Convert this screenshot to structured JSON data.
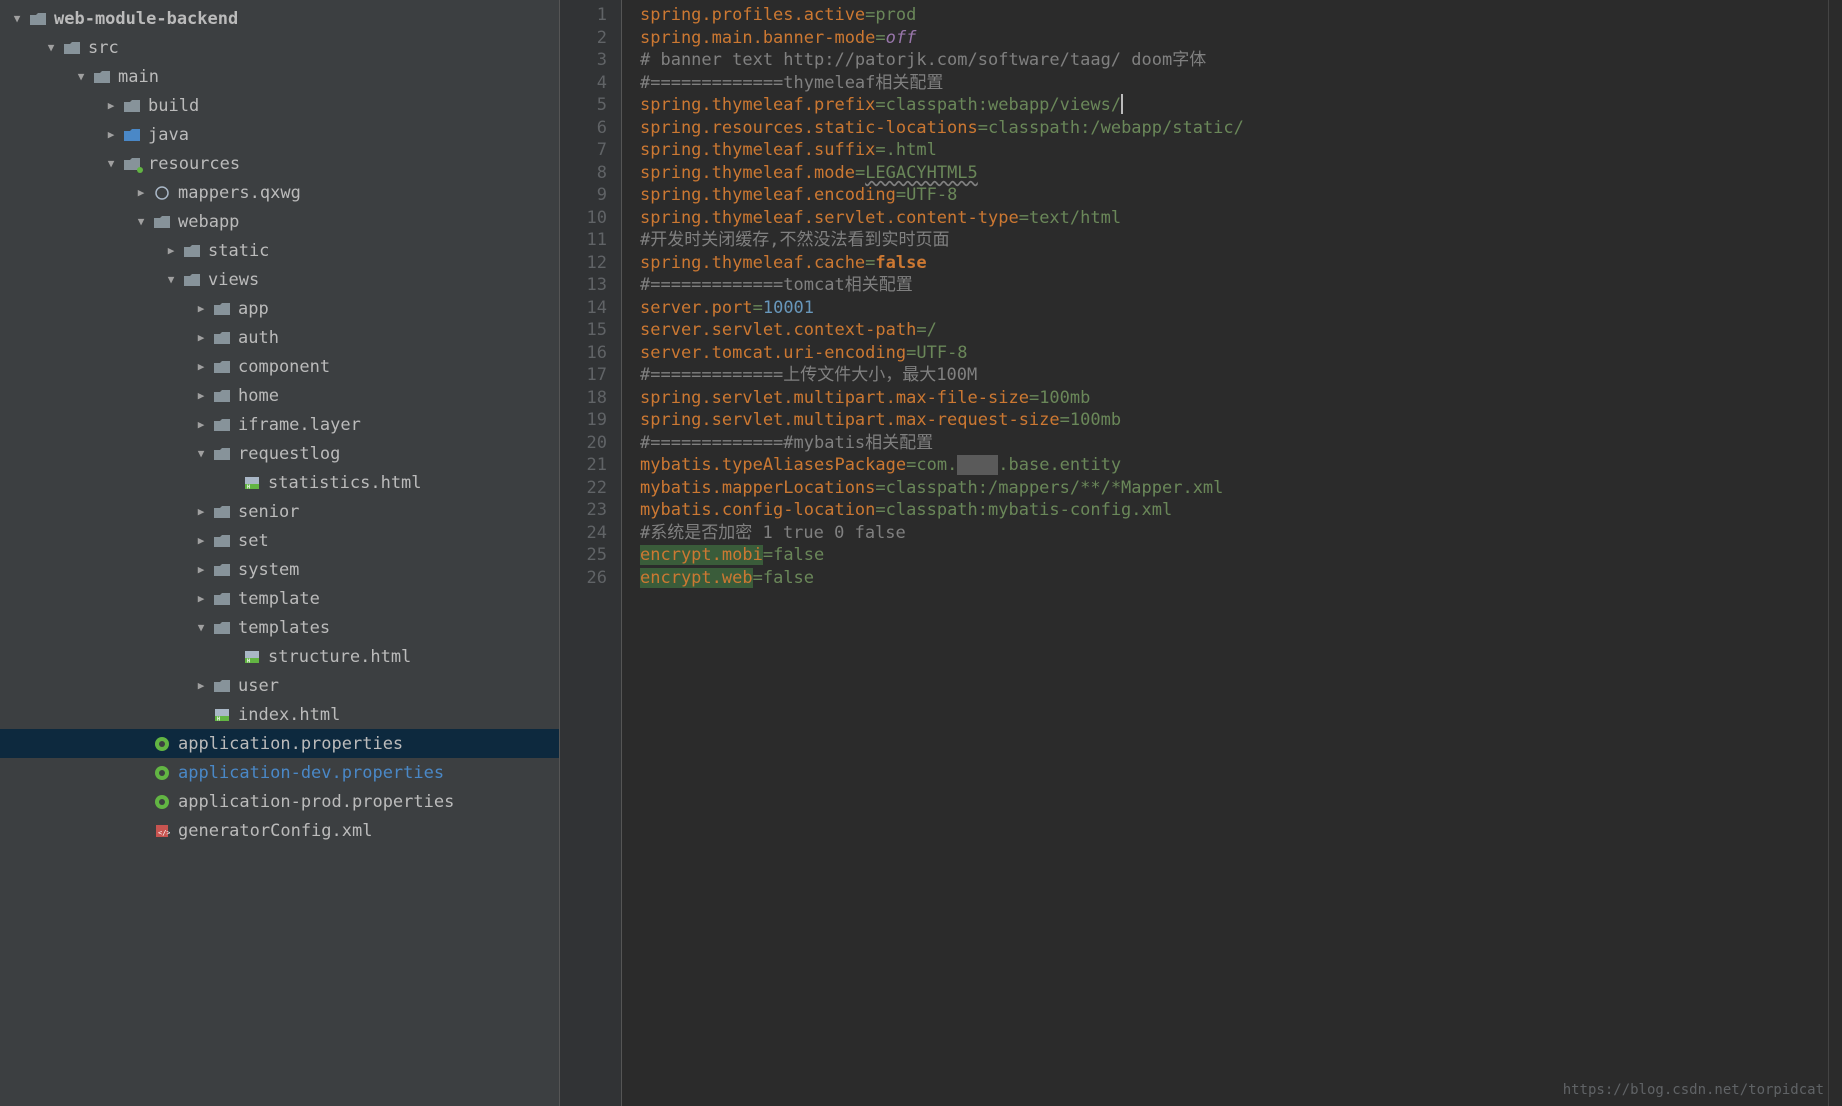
{
  "tree": {
    "root": {
      "label": "web-module-backend"
    },
    "src": {
      "label": "src"
    },
    "main": {
      "label": "main"
    },
    "build": {
      "label": "build"
    },
    "java": {
      "label": "java"
    },
    "resources": {
      "label": "resources"
    },
    "mappers": {
      "label": "mappers.qxwg"
    },
    "webapp": {
      "label": "webapp"
    },
    "static": {
      "label": "static"
    },
    "views": {
      "label": "views"
    },
    "app": {
      "label": "app"
    },
    "auth": {
      "label": "auth"
    },
    "component": {
      "label": "component"
    },
    "home": {
      "label": "home"
    },
    "iframe_layer": {
      "label": "iframe.layer"
    },
    "requestlog": {
      "label": "requestlog"
    },
    "statistics": {
      "label": "statistics.html"
    },
    "senior": {
      "label": "senior"
    },
    "set": {
      "label": "set"
    },
    "system": {
      "label": "system"
    },
    "template": {
      "label": "template"
    },
    "templates": {
      "label": "templates"
    },
    "structure": {
      "label": "structure.html"
    },
    "user": {
      "label": "user"
    },
    "index": {
      "label": "index.html"
    },
    "app_props": {
      "label": "application.properties"
    },
    "app_dev": {
      "label": "application-dev.properties"
    },
    "app_prod": {
      "label": "application-prod.properties"
    },
    "gen_cfg": {
      "label": "generatorConfig.xml"
    }
  },
  "code": {
    "l1_k": "spring.profiles.active",
    "l1_v": "prod",
    "l2_k": "spring.main.banner-mode",
    "l2_v": "off",
    "l3": "# banner text http://patorjk.com/software/taag/ doom字体",
    "l4": "#=============thymeleaf相关配置",
    "l5_k": "spring.thymeleaf.prefix",
    "l5_v": "classpath:webapp/views/",
    "l6_k": "spring.resources.static-locations",
    "l6_v": "classpath:/webapp/static/",
    "l7_k": "spring.thymeleaf.suffix",
    "l7_v": ".html",
    "l8_k": "spring.thymeleaf.mode",
    "l8_v": "LEGACYHTML5",
    "l9_k": "spring.thymeleaf.encoding",
    "l9_v": "UTF-8",
    "l10_k": "spring.thymeleaf.servlet.content-type",
    "l10_v": "text/html",
    "l11": "#开发时关闭缓存,不然没法看到实时页面",
    "l12_k": "spring.thymeleaf.cache",
    "l12_v": "false",
    "l13": "#=============tomcat相关配置",
    "l14_k": "server.port",
    "l14_v": "10001",
    "l15_k": "server.servlet.context-path",
    "l15_v": "/",
    "l16_k": "server.tomcat.uri-encoding",
    "l16_v": "UTF-8",
    "l17": "#=============上传文件大小，最大100M",
    "l18_k": "spring.servlet.multipart.max-file-size",
    "l18_v": "100mb",
    "l19_k": "spring.servlet.multipart.max-request-size",
    "l19_v": "100mb",
    "l20": "#=============#mybatis相关配置",
    "l21_k": "mybatis.typeAliasesPackage",
    "l21_v1": "com.",
    "l21_v2": ".base.entity",
    "l22_k": "mybatis.mapperLocations",
    "l22_v": "classpath:/mappers/**/*Mapper.xml",
    "l23_k": "mybatis.config-location",
    "l23_v": "classpath:mybatis-config.xml",
    "l24": "#系统是否加密 1 true 0 false",
    "l25_k": "encrypt.mobi",
    "l25_v": "false",
    "l26_k": "encrypt.web",
    "l26_v": "false"
  },
  "watermark": "https://blog.csdn.net/torpidcat",
  "line_numbers": [
    "1",
    "2",
    "3",
    "4",
    "5",
    "6",
    "7",
    "8",
    "9",
    "10",
    "11",
    "12",
    "13",
    "14",
    "15",
    "16",
    "17",
    "18",
    "19",
    "20",
    "21",
    "22",
    "23",
    "24",
    "25",
    "26"
  ]
}
